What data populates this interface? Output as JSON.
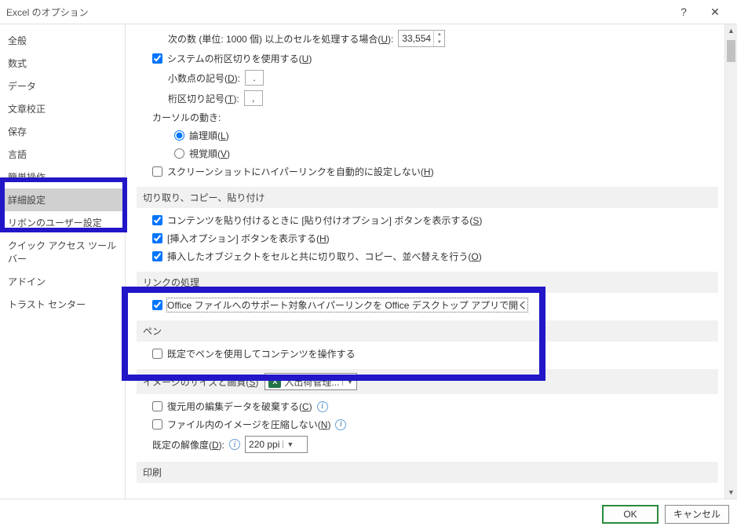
{
  "window": {
    "title": "Excel のオプション",
    "help_symbol": "?",
    "close_symbol": "✕"
  },
  "sidebar": {
    "items": [
      {
        "label": "全般"
      },
      {
        "label": "数式"
      },
      {
        "label": "データ"
      },
      {
        "label": "文章校正"
      },
      {
        "label": "保存"
      },
      {
        "label": "言語"
      },
      {
        "label": "簡単操作"
      },
      {
        "label": "詳細設定",
        "selected": true
      },
      {
        "label": "リボンのユーザー設定"
      },
      {
        "label": "クイック アクセス ツール バー"
      },
      {
        "label": "アドイン"
      },
      {
        "label": "トラスト センター"
      }
    ]
  },
  "main": {
    "cells_threshold_label_pre": "次の数 (単位: 1000 個) 以上のセルを処理する場合(",
    "cells_threshold_label_key": "U",
    "cells_threshold_label_post": "):",
    "cells_threshold_value": "33,554",
    "use_system_sep_pre": "システムの桁区切りを使用する(",
    "use_system_sep_key": "U",
    "use_system_sep_post": ")",
    "decimal_sep_label_pre": "小数点の記号(",
    "decimal_sep_label_key": "D",
    "decimal_sep_label_post": "):",
    "decimal_sep_value": ".",
    "thousand_sep_label_pre": "桁区切り記号(",
    "thousand_sep_label_key": "T",
    "thousand_sep_label_post": "):",
    "thousand_sep_value": ",",
    "cursor_label": "カーソルの動き:",
    "cursor_logical_pre": "論理順(",
    "cursor_logical_key": "L",
    "cursor_logical_post": ")",
    "cursor_visual_pre": "視覚順(",
    "cursor_visual_key": "V",
    "cursor_visual_post": ")",
    "screenshot_hyperlink_pre": "スクリーンショットにハイパーリンクを自動的に設定しない(",
    "screenshot_hyperlink_key": "H",
    "screenshot_hyperlink_post": ")",
    "section_cutcopy": "切り取り、コピー、貼り付け",
    "paste_options_pre": "コンテンツを貼り付けるときに [貼り付けオプション] ボタンを表示する(",
    "paste_options_key": "S",
    "paste_options_post": ")",
    "insert_options_pre": "[挿入オプション] ボタンを表示する(",
    "insert_options_key": "H",
    "insert_options_post": ")",
    "inserted_objects_pre": "挿入したオブジェクトをセルと共に切り取り、コピー、並べ替えを行う(",
    "inserted_objects_key": "O",
    "inserted_objects_post": ")",
    "section_link": "リンクの処理",
    "office_link_label": "Office ファイルへのサポート対象ハイパーリンクを Office デスクトップ アプリで開く",
    "section_pen": "ペン",
    "pen_default_label": "既定でペンを使用してコンテンツを操作する",
    "section_image_pre": "イメージのサイズと画質(",
    "section_image_key": "S",
    "section_image_post": ")",
    "image_workbook": "入出荷管理...",
    "discard_edit_pre": "復元用の編集データを破棄する(",
    "discard_edit_key": "C",
    "discard_edit_post": ")",
    "no_compress_pre": "ファイル内のイメージを圧縮しない(",
    "no_compress_key": "N",
    "no_compress_post": ")",
    "default_res_pre": "既定の解像度(",
    "default_res_key": "D",
    "default_res_post": "):",
    "default_res_value": "220 ppi",
    "section_print": "印刷"
  },
  "footer": {
    "ok": "OK",
    "cancel": "キャンセル"
  }
}
